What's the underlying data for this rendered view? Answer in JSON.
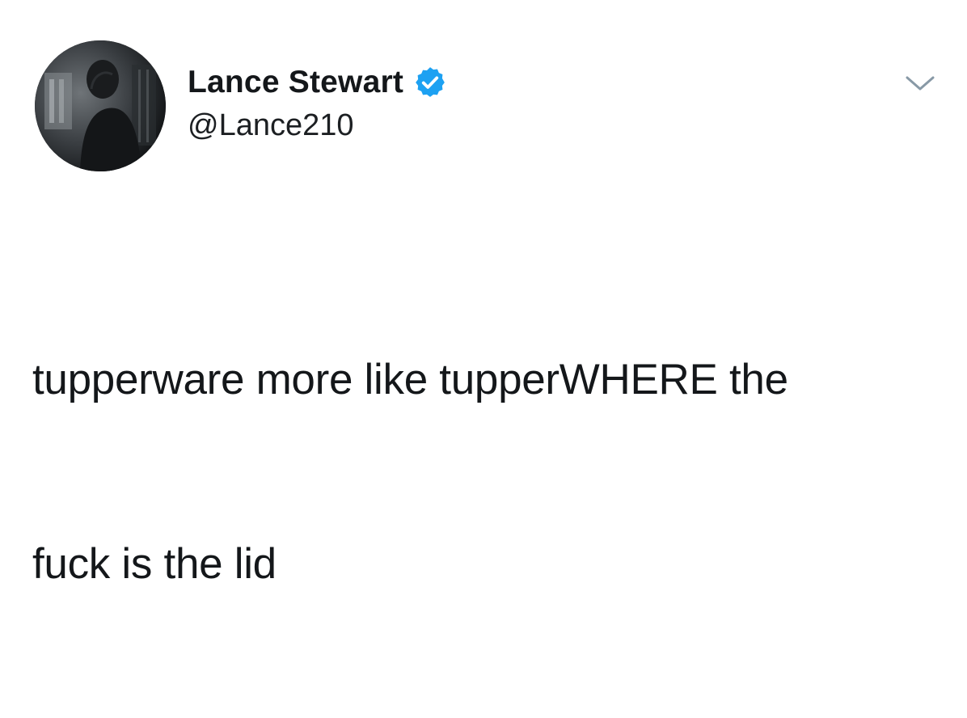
{
  "tweet": {
    "author": {
      "name": "Lance Stewart",
      "handle": "@Lance210",
      "verified": true,
      "avatar": "profile-photo"
    },
    "text_lines": [
      "tupperware more like tupperWHERE the",
      "fuck is the lid"
    ],
    "more_menu_icon": "chevron-down-icon"
  },
  "colors": {
    "verified_badge": "#1da1f2",
    "text": "#14171a",
    "background": "#ffffff",
    "chevron": "#8899a6"
  }
}
